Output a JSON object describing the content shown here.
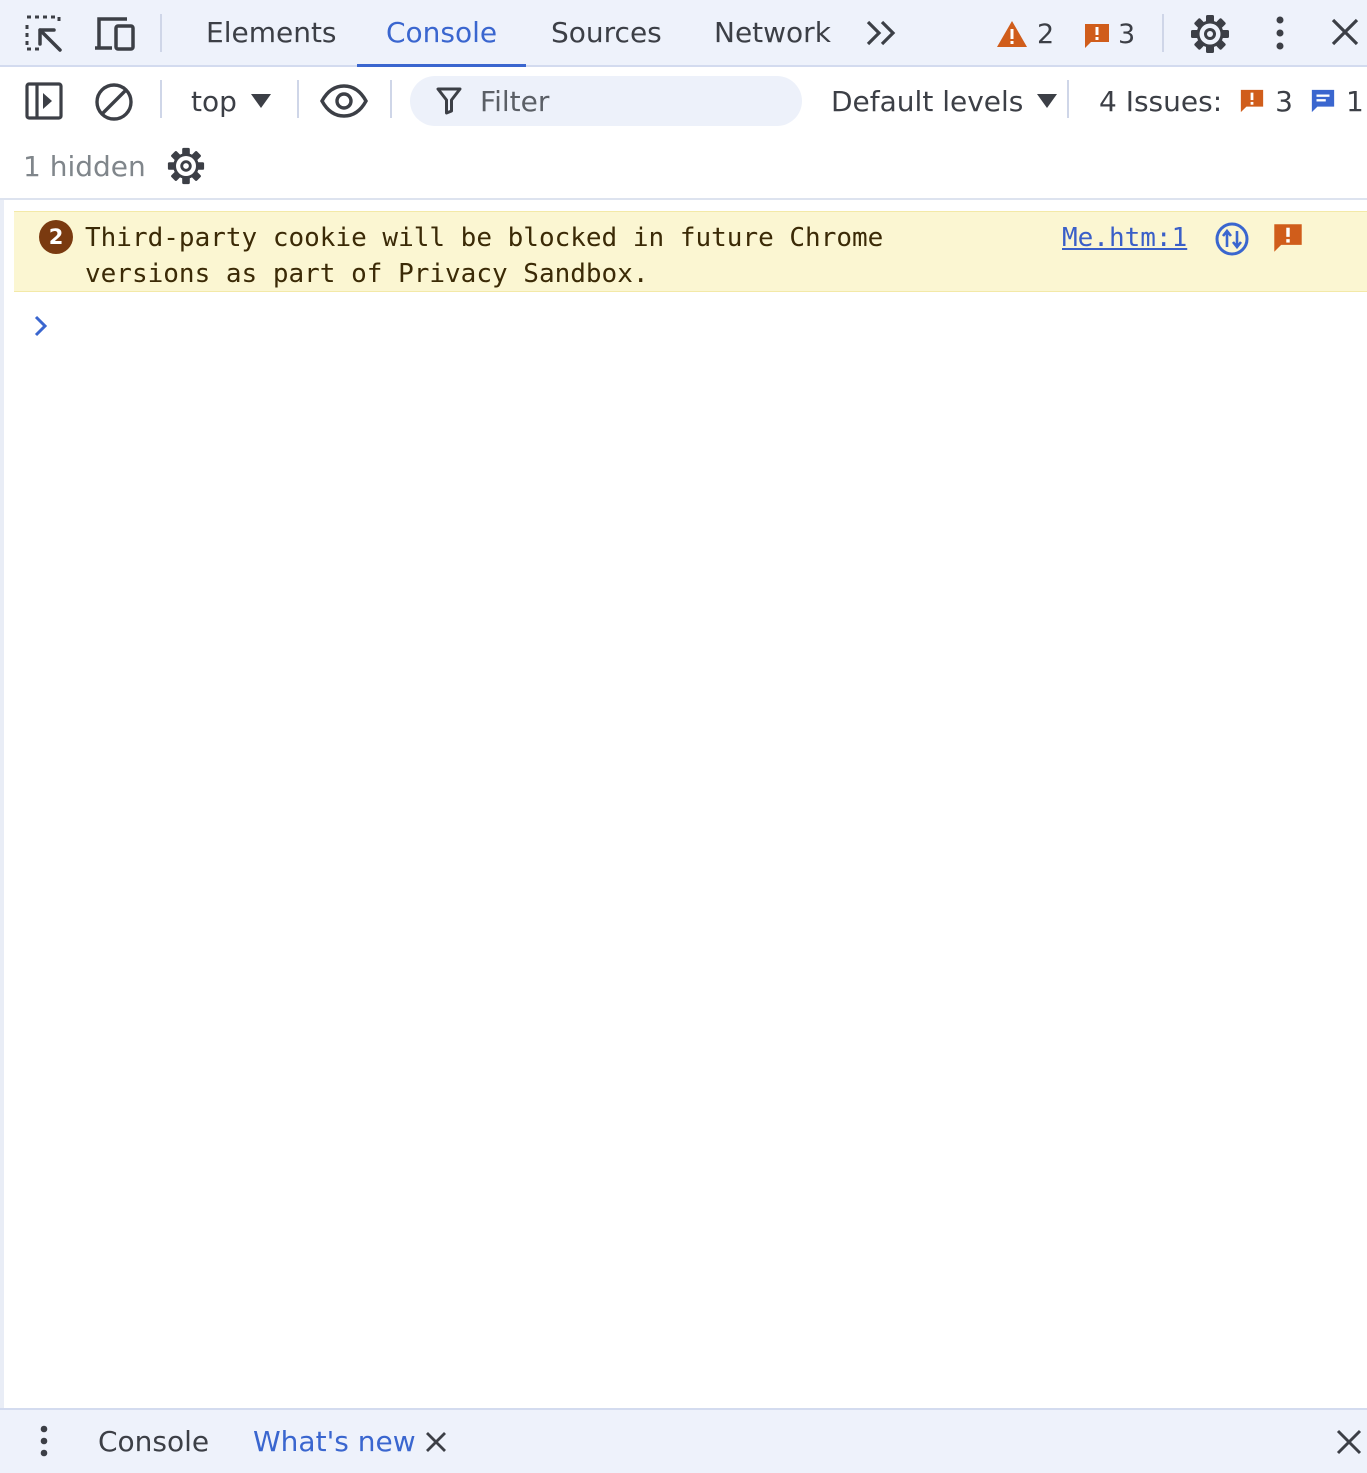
{
  "tabs": [
    {
      "label": "Elements"
    },
    {
      "label": "Console"
    },
    {
      "label": "Sources"
    },
    {
      "label": "Network"
    }
  ],
  "status": {
    "warnings_count": "2",
    "issues_count": "3"
  },
  "toolbar": {
    "context": "top",
    "filter_placeholder": "Filter",
    "levels": "Default levels",
    "issues_label": "4 Issues:",
    "issues_error_count": "3",
    "issues_info_count": "1",
    "hidden_label": "1 hidden"
  },
  "messages": [
    {
      "repeat_count": "2",
      "text": "Third-party cookie will be blocked in future Chrome\nversions as part of Privacy Sandbox.",
      "source": "Me.htm:1"
    }
  ],
  "drawer": {
    "tabs": [
      {
        "label": "Console"
      },
      {
        "label": "What's new"
      }
    ]
  },
  "colors": {
    "accent": "#3a66cf",
    "warning": "#d05d1b",
    "warning_bg": "#fbf6d2"
  }
}
